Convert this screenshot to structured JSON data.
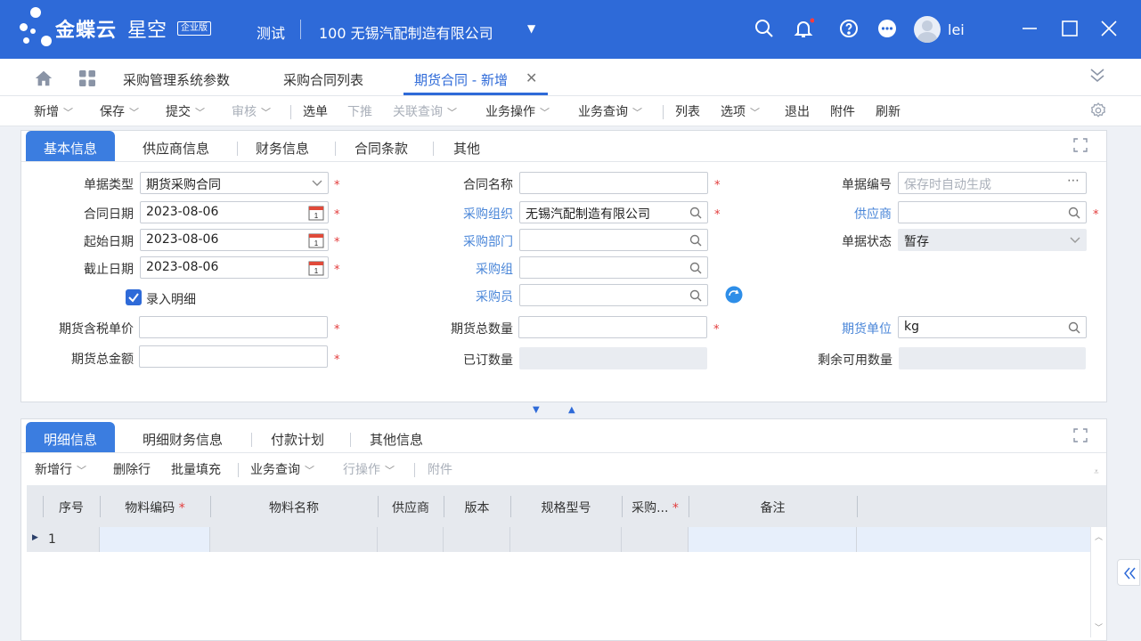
{
  "app": {
    "brand": "金蝶云",
    "brand_sub": "星空",
    "edition_badge": "企业版",
    "env": "测试",
    "org": "100  无锡汽配制造有限公司",
    "user": "lei"
  },
  "nav_tabs": [
    {
      "label": "采购管理系统参数"
    },
    {
      "label": "采购合同列表"
    },
    {
      "label": "期货合同 - 新增"
    }
  ],
  "toolbar": {
    "items": [
      "新增",
      "保存",
      "提交",
      "审核",
      "选单",
      "下推",
      "关联查询",
      "业务操作",
      "业务查询",
      "列表",
      "选项",
      "退出",
      "附件",
      "刷新"
    ]
  },
  "header_tabs": [
    "基本信息",
    "供应商信息",
    "财务信息",
    "合同条款",
    "其他"
  ],
  "form": {
    "doc_type_label": "单据类型",
    "doc_type_value": "期货采购合同",
    "contract_date_label": "合同日期",
    "contract_date_value": "2023-08-06",
    "start_date_label": "起始日期",
    "start_date_value": "2023-08-06",
    "end_date_label": "截止日期",
    "end_date_value": "2023-08-06",
    "enter_detail_label": "录入明细",
    "unit_price_label": "期货含税单价",
    "total_amount_label": "期货总金额",
    "contract_name_label": "合同名称",
    "purchase_org_label": "采购组织",
    "purchase_org_value": "无锡汽配制造有限公司",
    "purchase_dept_label": "采购部门",
    "purchase_group_label": "采购组",
    "buyer_label": "采购员",
    "total_qty_label": "期货总数量",
    "ordered_qty_label": "已订数量",
    "doc_no_label": "单据编号",
    "doc_no_placeholder": "保存时自动生成",
    "supplier_label": "供应商",
    "doc_status_label": "单据状态",
    "doc_status_value": "暂存",
    "unit_label": "期货单位",
    "unit_value": "kg",
    "remaining_qty_label": "剩余可用数量"
  },
  "detail_tabs": [
    "明细信息",
    "明细财务信息",
    "付款计划",
    "其他信息"
  ],
  "detail_toolbar": [
    "新增行",
    "删除行",
    "批量填充",
    "业务查询",
    "行操作",
    "附件"
  ],
  "grid": {
    "columns": [
      "序号",
      "物料编码",
      "物料名称",
      "供应商",
      "版本",
      "规格型号",
      "采购...",
      "备注"
    ],
    "rows": [
      {
        "seq": "1"
      }
    ]
  }
}
